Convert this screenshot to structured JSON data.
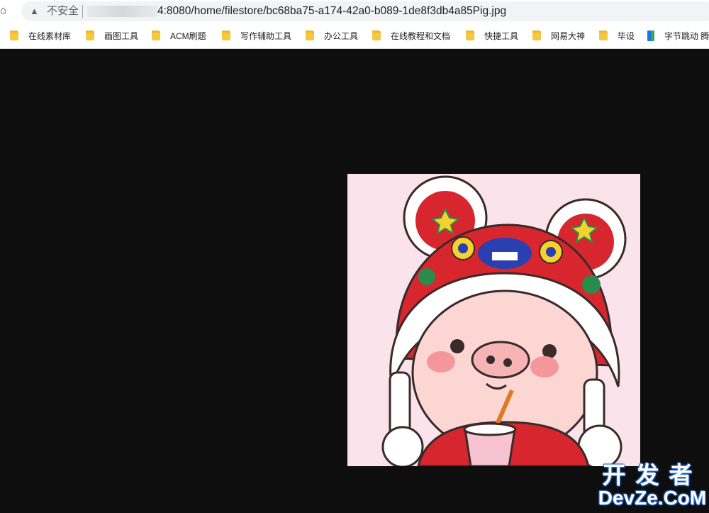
{
  "address_bar": {
    "home_icon": "home-icon",
    "warning_icon": "warning-triangle-icon",
    "security_label": "不安全",
    "url_visible": "4:8080/home/filestore/bc68ba75-a174-42a0-b089-1de8f3db4a85Pig.jpg"
  },
  "bookmarks": [
    {
      "label": "在线素材库",
      "icon": "folder-icon"
    },
    {
      "label": "画图工具",
      "icon": "folder-icon"
    },
    {
      "label": "ACM刷题",
      "icon": "folder-icon"
    },
    {
      "label": "写作辅助工具",
      "icon": "folder-icon"
    },
    {
      "label": "办公工具",
      "icon": "folder-icon"
    },
    {
      "label": "在线教程和文档",
      "icon": "folder-icon"
    },
    {
      "label": "快捷工具",
      "icon": "folder-icon"
    },
    {
      "label": "网易大神",
      "icon": "folder-icon"
    },
    {
      "label": "毕设",
      "icon": "folder-icon"
    },
    {
      "label": "字节跳动 腾",
      "icon": "app-icon"
    }
  ],
  "watermark": {
    "line1": "开发者",
    "line2": "DevZe.CoM"
  },
  "colors": {
    "page_background": "#0e0e0e",
    "image_background": "#fbe3ec",
    "hat_red": "#d8262e",
    "watermark_outline": "#2b6fd6"
  }
}
